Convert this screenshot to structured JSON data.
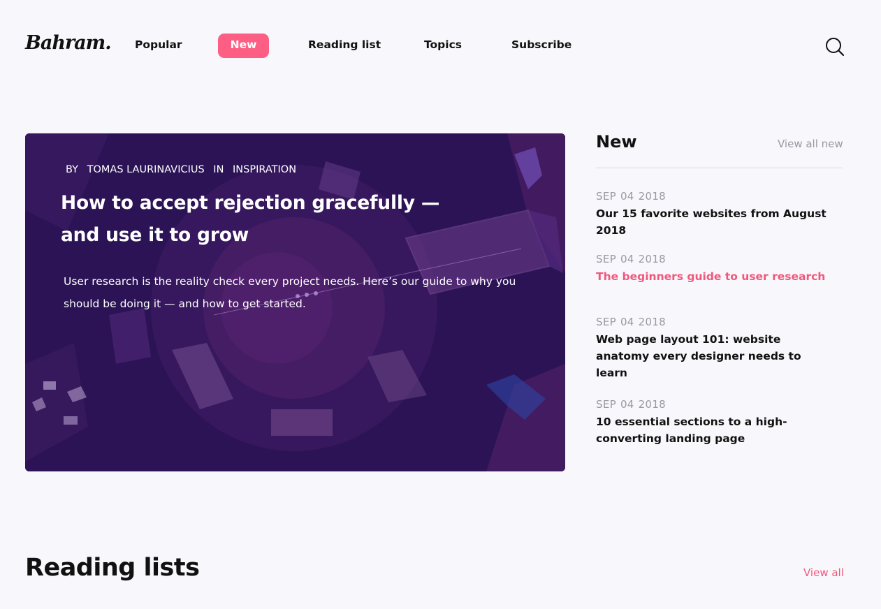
{
  "brand": {
    "logo_text": "Bahram."
  },
  "nav": {
    "items": [
      {
        "label": "Popular",
        "active": false
      },
      {
        "label": "New",
        "active": true
      },
      {
        "label": "Reading list",
        "active": false
      },
      {
        "label": "Topics",
        "active": false
      },
      {
        "label": "Subscribe",
        "active": false
      }
    ],
    "search_icon": "search-icon"
  },
  "hero": {
    "by_label": "BY",
    "author": "TOMAS LAURINAVICIUS",
    "in_label": "IN",
    "category": "INSPIRATION",
    "title": "How to accept rejection gracefully — and use it to grow",
    "description": "User research is the reality check every project needs. Here’s our guide to why you should be doing it — and how to get started."
  },
  "sidebar": {
    "title": "New",
    "view_all": "View all new",
    "items": [
      {
        "month": "SEP",
        "day": "04",
        "year": "2018",
        "title": "Our 15 favorite websites from August 2018",
        "highlighted": false
      },
      {
        "month": "SEP",
        "day": "04",
        "year": "2018",
        "title": "The beginners guide to user research",
        "highlighted": true
      },
      {
        "month": "SEP",
        "day": "04",
        "year": "2018",
        "title": "Web page layout 101: website anatomy every designer needs to learn",
        "highlighted": false
      },
      {
        "month": "SEP",
        "day": "04",
        "year": "2018",
        "title": "10 essential sections to a high-converting landing page",
        "highlighted": false
      }
    ]
  },
  "reading_lists": {
    "title": "Reading lists",
    "view_all": "View all"
  },
  "colors": {
    "accent": "#fd5f84",
    "hero_bg": "#2c1456",
    "muted_text": "#9a98a2",
    "page_bg": "#f8f7fb"
  }
}
